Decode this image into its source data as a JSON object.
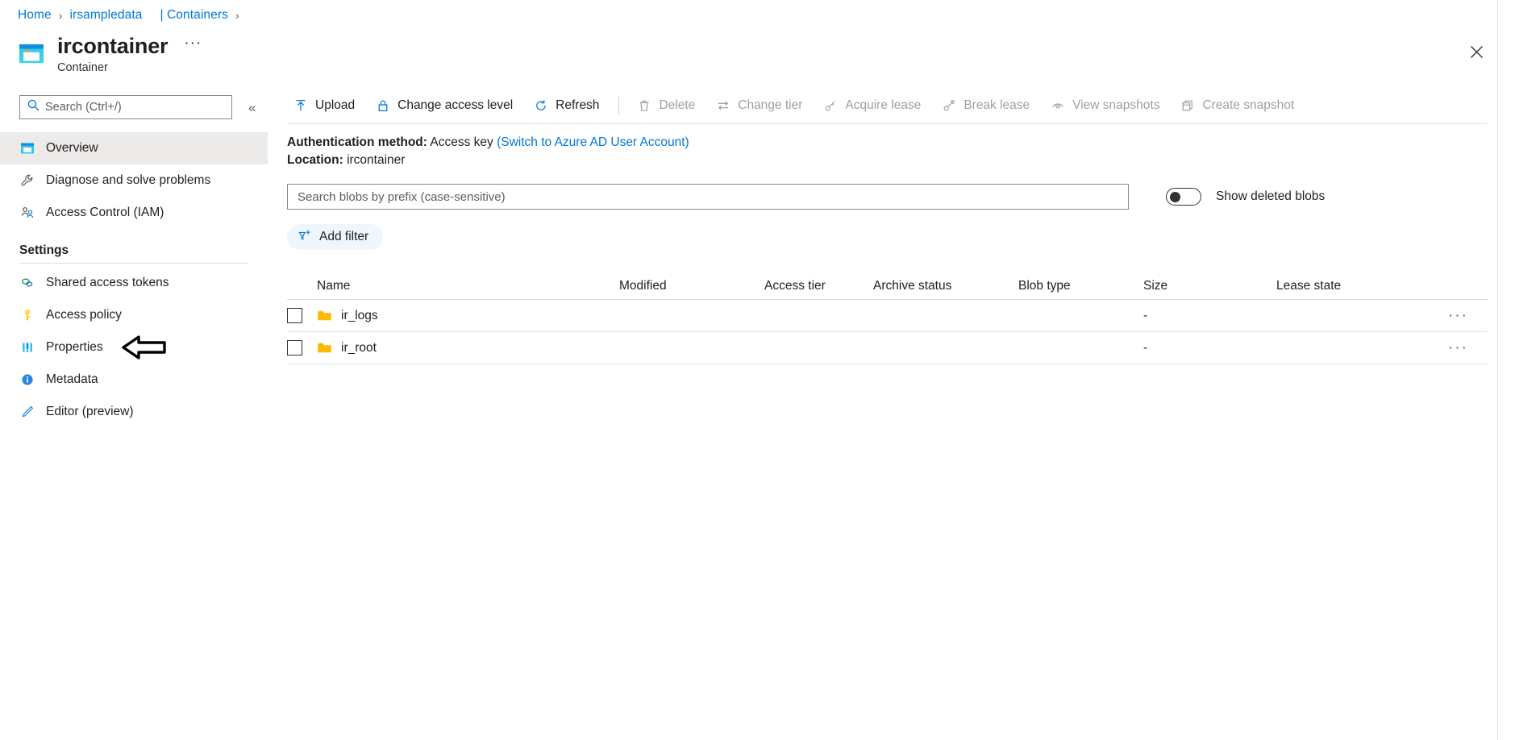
{
  "breadcrumb": {
    "items": [
      {
        "label": "Home",
        "type": "link"
      },
      {
        "label": "irsampledata",
        "type": "link"
      },
      {
        "label": "| Containers",
        "type": "link"
      }
    ],
    "separator": "›"
  },
  "header": {
    "title": "ircontainer",
    "subtitle": "Container",
    "ellipsis": "···",
    "icon": "container-icon",
    "close_icon": "close-icon"
  },
  "sidebar": {
    "search": {
      "placeholder": "Search (Ctrl+/)",
      "value": "",
      "icon": "search-icon"
    },
    "collapse_icon": "chevron-double-left-icon",
    "items": [
      {
        "label": "Overview",
        "icon": "overview-icon",
        "active": true
      },
      {
        "label": "Diagnose and solve problems",
        "icon": "wrench-icon",
        "active": false
      },
      {
        "label": "Access Control (IAM)",
        "icon": "people-icon",
        "active": false
      }
    ],
    "section": {
      "label": "Settings"
    },
    "settings_items": [
      {
        "label": "Shared access tokens",
        "icon": "link-rings-icon",
        "active": false
      },
      {
        "label": "Access policy",
        "icon": "key-icon",
        "active": false
      },
      {
        "label": "Properties",
        "icon": "bars-icon",
        "active": false
      },
      {
        "label": "Metadata",
        "icon": "info-icon",
        "active": false
      },
      {
        "label": "Editor (preview)",
        "icon": "pencil-icon",
        "active": false
      }
    ]
  },
  "annotation": {
    "arrow": "left-pointing-arrow",
    "points_to": "Properties"
  },
  "toolbar": {
    "commands": [
      {
        "label": "Upload",
        "icon": "upload-arrow-icon",
        "disabled": false
      },
      {
        "label": "Change access level",
        "icon": "lock-icon",
        "disabled": false
      },
      {
        "label": "Refresh",
        "icon": "refresh-icon",
        "disabled": false
      },
      {
        "separator": true
      },
      {
        "label": "Delete",
        "icon": "trash-icon",
        "disabled": true
      },
      {
        "label": "Change tier",
        "icon": "swap-arrows-icon",
        "disabled": true
      },
      {
        "label": "Acquire lease",
        "icon": "lease-icon",
        "disabled": true
      },
      {
        "label": "Break lease",
        "icon": "break-lease-icon",
        "disabled": true
      },
      {
        "label": "View snapshots",
        "icon": "snapshot-view-icon",
        "disabled": true
      },
      {
        "label": "Create snapshot",
        "icon": "snapshot-create-icon",
        "disabled": true
      }
    ]
  },
  "info": {
    "auth_label": "Authentication method:",
    "auth_value": "Access key",
    "auth_switch_link": "(Switch to Azure AD User Account)",
    "location_label": "Location:",
    "location_value": "ircontainer"
  },
  "filters": {
    "blob_search_placeholder": "Search blobs by prefix (case-sensitive)",
    "blob_search_value": "",
    "show_deleted_label": "Show deleted blobs",
    "show_deleted_on": false,
    "add_filter_label": "Add filter",
    "add_filter_icon": "add-filter-icon"
  },
  "table": {
    "columns": [
      "Name",
      "Modified",
      "Access tier",
      "Archive status",
      "Blob type",
      "Size",
      "Lease state"
    ],
    "rows": [
      {
        "checked": false,
        "icon": "folder-icon",
        "name": "ir_logs",
        "modified": "",
        "access_tier": "",
        "archive_status": "",
        "blob_type": "",
        "size": "-",
        "lease_state": "",
        "menu": "···"
      },
      {
        "checked": false,
        "icon": "folder-icon",
        "name": "ir_root",
        "modified": "",
        "access_tier": "",
        "archive_status": "",
        "blob_type": "",
        "size": "-",
        "lease_state": "",
        "menu": "···"
      }
    ]
  },
  "colors": {
    "accent": "#0078d4",
    "folder": "#ffb900",
    "active_row": "#edebe9",
    "border": "#e1dfdd",
    "disabled_text": "#a19f9d",
    "chip_bg": "#eff6fc"
  }
}
